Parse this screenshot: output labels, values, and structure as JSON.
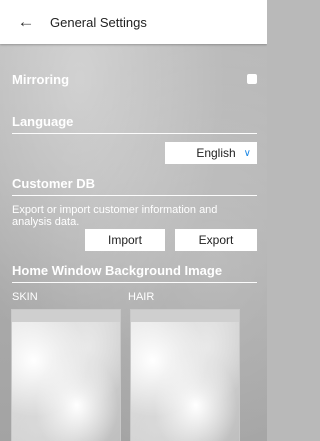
{
  "header": {
    "title": "General Settings",
    "back_icon": "arrow-left-icon"
  },
  "mirroring": {
    "label": "Mirroring",
    "checked": false
  },
  "language": {
    "title": "Language",
    "selected": "English",
    "chevron_icon": "chevron-down-icon",
    "accent": "#1e88e5"
  },
  "customer_db": {
    "title": "Customer DB",
    "description": "Export or import customer information and analysis data.",
    "import_label": "Import",
    "export_label": "Export"
  },
  "background": {
    "title": "Home Window Background Image",
    "skin_label": "SKIN",
    "hair_label": "HAIR"
  }
}
